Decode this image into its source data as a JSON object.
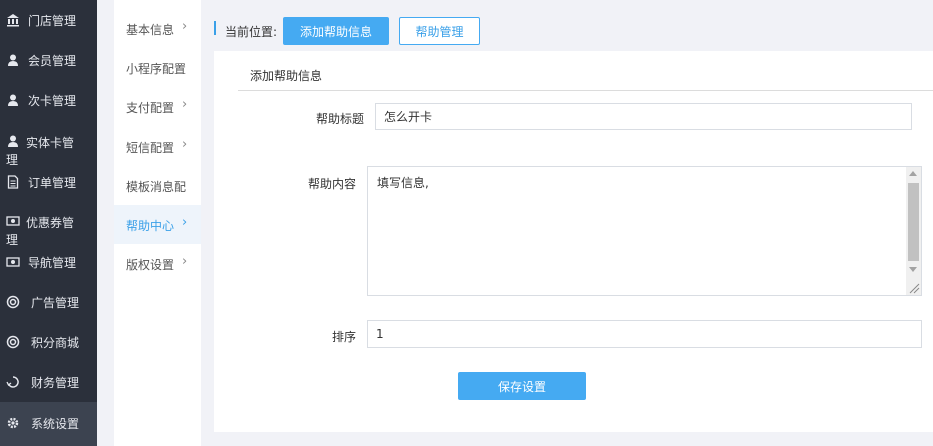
{
  "sidebar": {
    "items": [
      {
        "label": "门店管理",
        "icon": "bank-icon"
      },
      {
        "label": "会员管理",
        "icon": "user-icon"
      },
      {
        "label": "次卡管理",
        "icon": "user-icon"
      },
      {
        "label": "实体卡管",
        "label2": "理",
        "icon": "user-icon"
      },
      {
        "label": "订单管理",
        "icon": "document-icon"
      },
      {
        "label": "优惠券管",
        "label2": "理",
        "icon": "ticket-icon"
      },
      {
        "label": "导航管理",
        "icon": "ticket-icon"
      },
      {
        "label": "广告管理",
        "icon": "lifebuoy-icon"
      },
      {
        "label": "积分商城",
        "icon": "lifebuoy-icon"
      },
      {
        "label": "财务管理",
        "icon": "recycle-icon"
      },
      {
        "label": "系统设置",
        "icon": "gear-icon"
      }
    ],
    "active_index": 10
  },
  "subnav": {
    "items": [
      {
        "label": "基本信息",
        "chevron": true
      },
      {
        "label": "小程序配置",
        "chevron": false
      },
      {
        "label": "支付配置",
        "chevron": true
      },
      {
        "label": "短信配置",
        "chevron": true
      },
      {
        "label": "模板消息配",
        "chevron": false
      },
      {
        "label": "帮助中心",
        "chevron": true
      },
      {
        "label": "版权设置",
        "chevron": true
      }
    ],
    "active_index": 5,
    "chevron_glyph": "›"
  },
  "breadcrumb": {
    "label": "当前位置:",
    "primary_button": "添加帮助信息",
    "secondary_button": "帮助管理"
  },
  "panel": {
    "title": "添加帮助信息"
  },
  "form": {
    "title_label": "帮助标题",
    "title_value": "怎么开卡",
    "content_label": "帮助内容",
    "content_value": "填写信息,",
    "order_label": "排序",
    "order_value": "1",
    "save_label": "保存设置"
  },
  "colors": {
    "sidebar_bg": "#2b303b",
    "accent": "#45aaf2",
    "page_bg": "#f1f2f7"
  }
}
